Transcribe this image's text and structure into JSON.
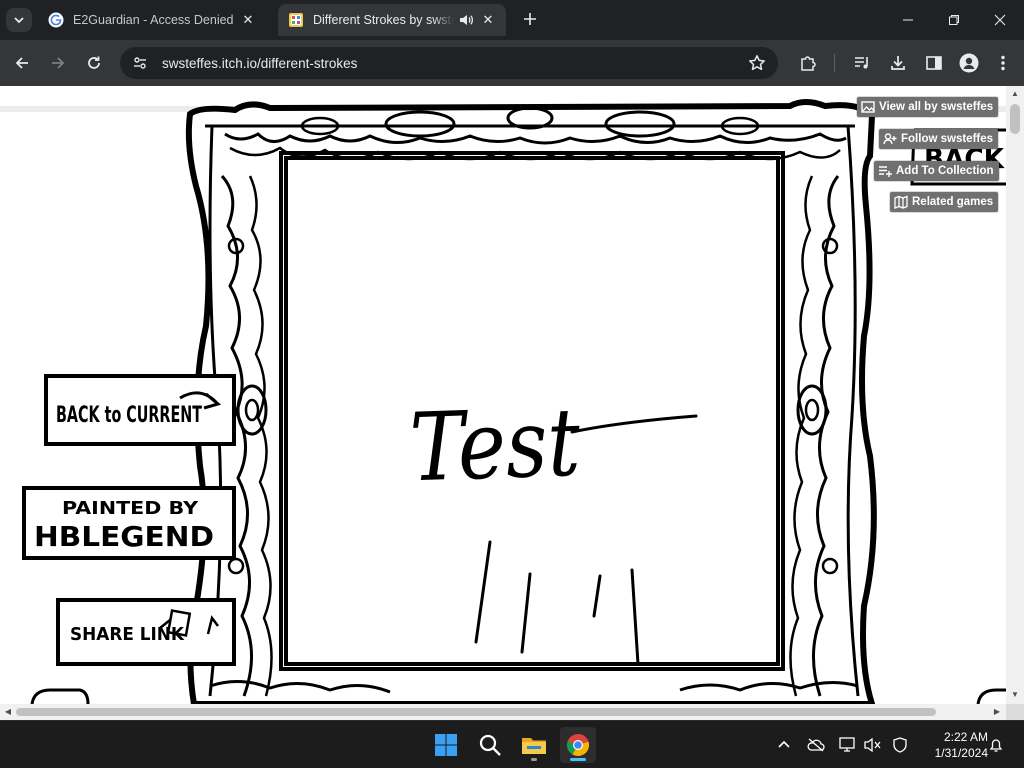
{
  "tabs": [
    {
      "title": "E2Guardian - Access Denied",
      "state": "inactive",
      "favicon": "google-g-icon"
    },
    {
      "title": "Different Strokes by swsteffes",
      "state": "active",
      "favicon": "itch-game-icon",
      "audio": "speaker-icon"
    }
  ],
  "toolbar": {
    "url": "swsteffes.itch.io/different-strokes"
  },
  "itch_buttons": {
    "view_all": "View all by swsteffes",
    "follow": "Follow swsteffes",
    "add_collection": "Add To Collection",
    "related": "Related games"
  },
  "game": {
    "frame_text": "Test",
    "back_to_current": "BACK to CURRENT",
    "painted_by_line1": "PAINTED BY",
    "painted_by_name": "HBLEGEND",
    "share_link": "SHARE LINK",
    "back": "BACK"
  },
  "taskbar": {
    "apps": [
      "windows-start-icon",
      "search-icon",
      "file-explorer-icon",
      "chrome-icon"
    ],
    "time": "2:22 AM",
    "date": "1/31/2024"
  },
  "colors": {
    "chrome_dark": "#202124",
    "chrome_toolbar": "#35363a",
    "itch_button": "#707070",
    "taskbar": "#1c1c1c"
  }
}
